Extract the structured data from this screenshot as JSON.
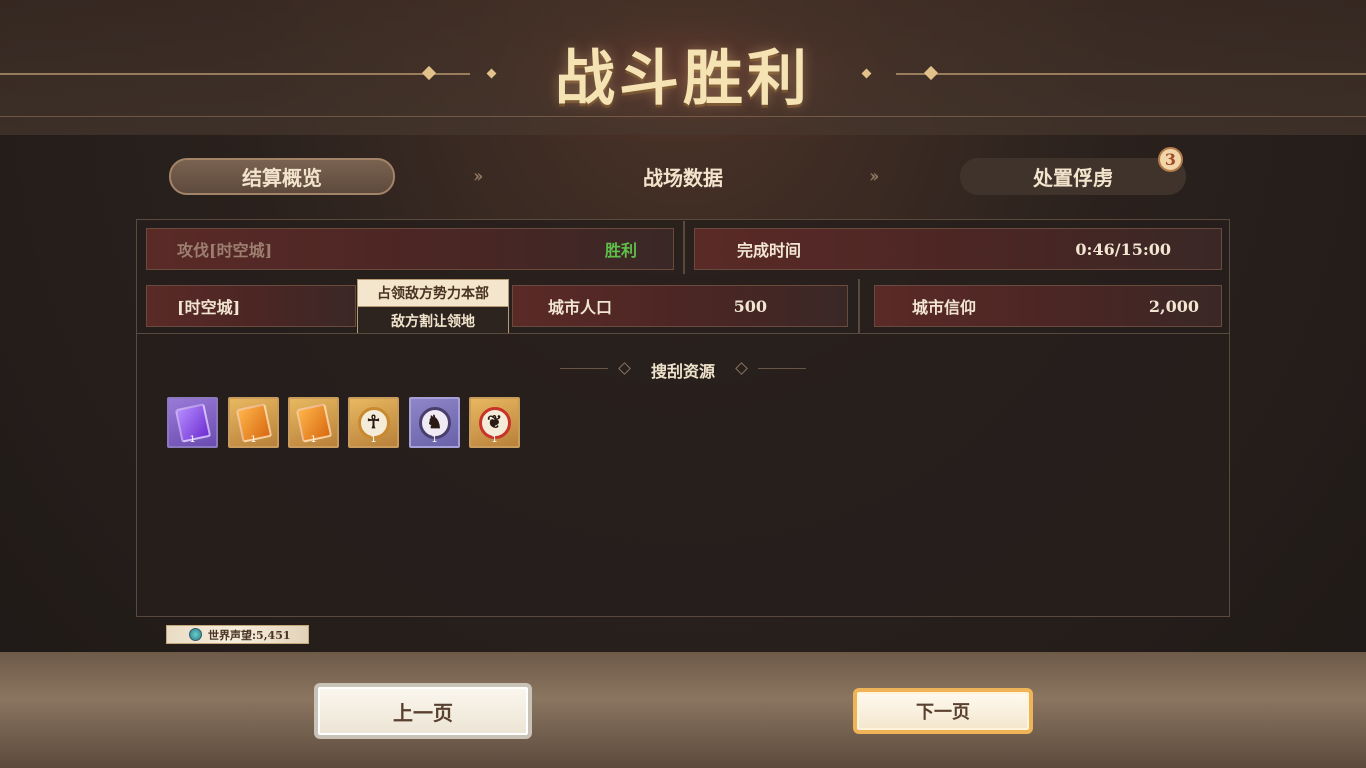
{
  "header": {
    "title": "战斗胜利"
  },
  "tabs": [
    {
      "label": "结算概览",
      "active": true
    },
    {
      "label": "战场数据",
      "active": false
    },
    {
      "label": "处置俘虏",
      "active": false,
      "badge": "3"
    }
  ],
  "summary": {
    "row1": {
      "battle_label": "攻伐[时空城]",
      "battle_result": "胜利",
      "time_label": "完成时间",
      "time_value": "0:46/15:00"
    },
    "row2": {
      "city_label": "[时空城]",
      "population_label": "城市人口",
      "population_value": "500",
      "faith_label": "城市信仰",
      "faith_value": "2,000"
    },
    "dropdown": {
      "selected": "占领敌方势力本部",
      "other": "敌方割让领地"
    }
  },
  "loot": {
    "title": "搜刮资源",
    "items": [
      {
        "icon": "purple-book-icon",
        "count": "1"
      },
      {
        "icon": "orange-book-icon",
        "count": "1"
      },
      {
        "icon": "orange-book-icon",
        "count": "1"
      },
      {
        "icon": "gold-emblem-icon",
        "count": "1"
      },
      {
        "icon": "dark-emblem-icon",
        "count": "1"
      },
      {
        "icon": "red-emblem-icon",
        "count": "1"
      }
    ]
  },
  "fame": {
    "text": "世界声望:5,451"
  },
  "buttons": {
    "prev": "上一页",
    "next": "下一页"
  },
  "colors": {
    "victory_green": "#5ec04a",
    "title_gold": "#f5e3b3",
    "next_border": "#f0b458"
  }
}
